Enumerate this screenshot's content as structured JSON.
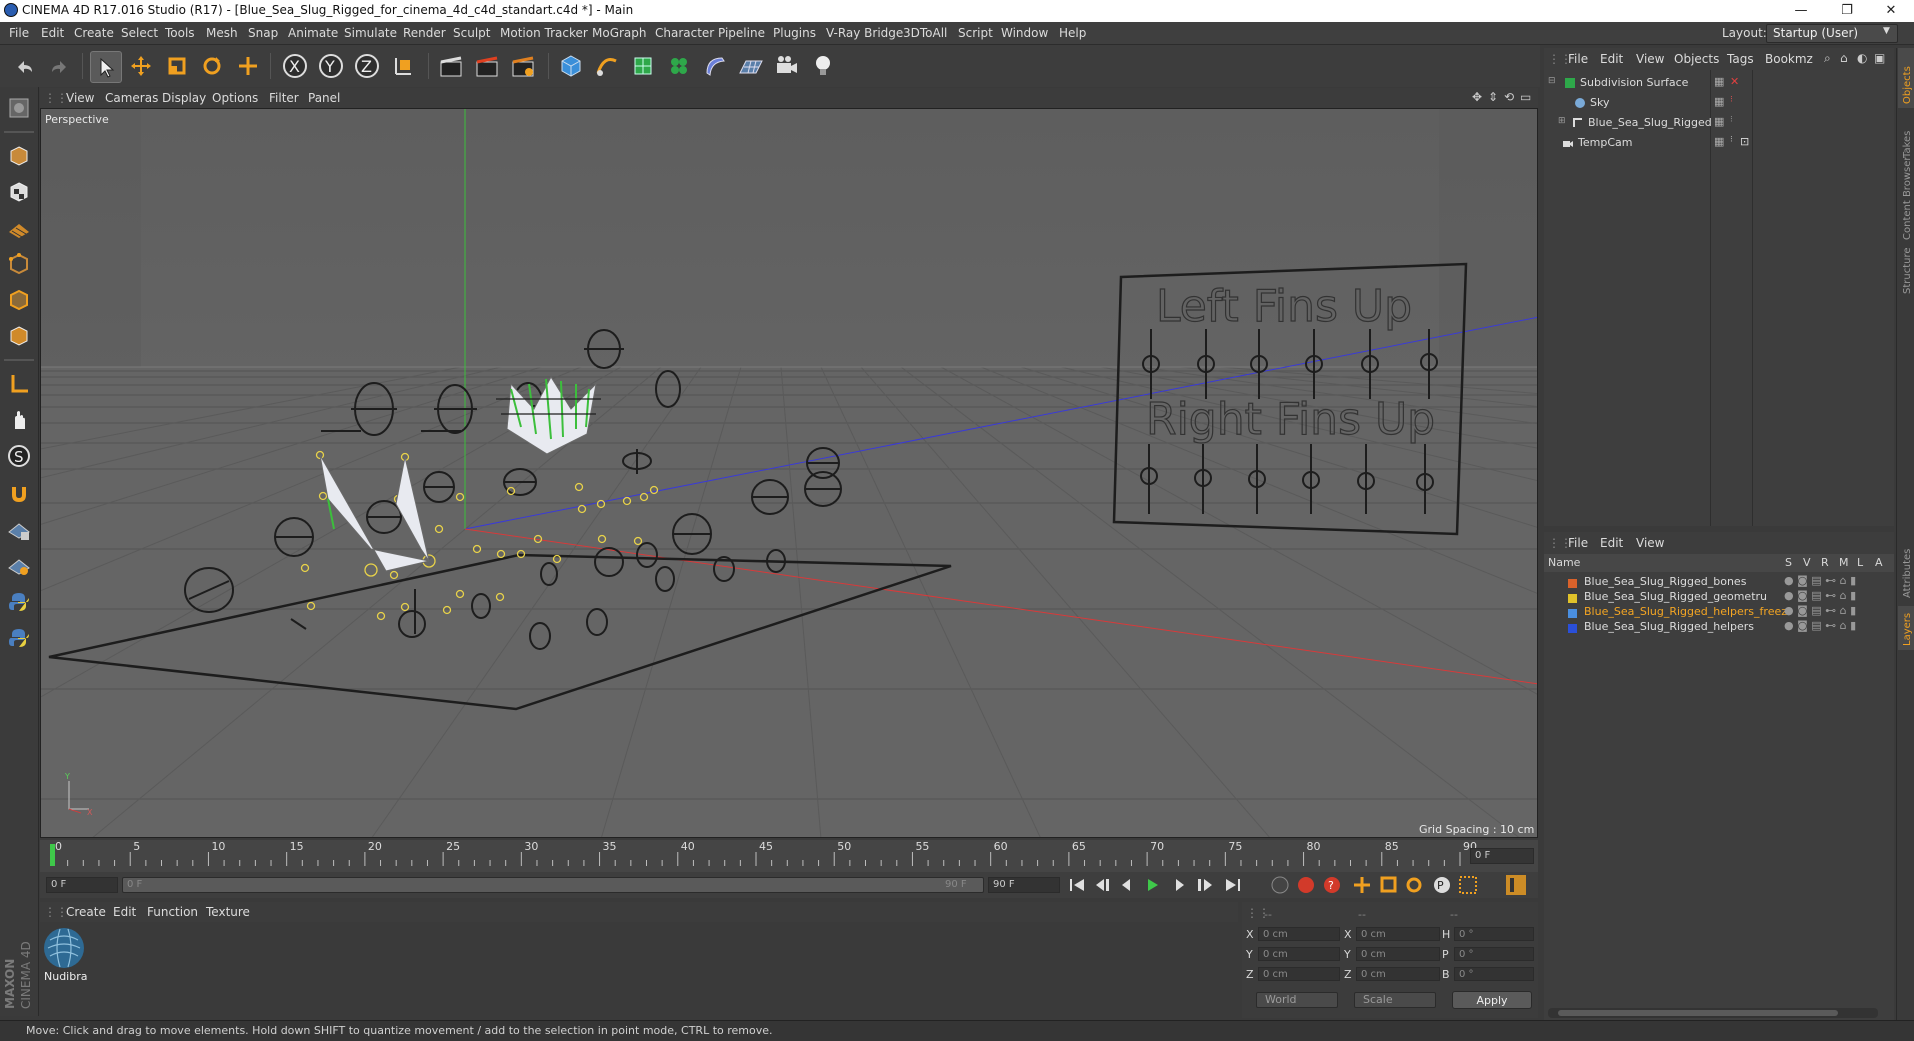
{
  "window": {
    "title": "CINEMA 4D R17.016 Studio (R17) - [Blue_Sea_Slug_Rigged_for_cinema_4d_c4d_standart.c4d *] - Main",
    "minimize": "—",
    "maximize": "❐",
    "close": "✕"
  },
  "menubar": {
    "items": [
      "File",
      "Edit",
      "Create",
      "Select",
      "Tools",
      "Mesh",
      "Snap",
      "Animate",
      "Simulate",
      "Render",
      "Sculpt",
      "Motion Tracker",
      "MoGraph",
      "Character",
      "Pipeline",
      "Plugins",
      "V-Ray Bridge",
      "3DToAll",
      "Script",
      "Window",
      "Help"
    ],
    "layout_label": "Layout:",
    "layout_value": "Startup (User)"
  },
  "viewport": {
    "menu": [
      "View",
      "Cameras",
      "Display",
      "Options",
      "Filter",
      "Panel"
    ],
    "camera_label": "Perspective",
    "grid_spacing": "Grid Spacing : 10 cm",
    "board_text_top": "Left Fins Up",
    "board_text_bottom": "Right Fins Up"
  },
  "timeline": {
    "ticks": [
      "0",
      "5",
      "10",
      "15",
      "20",
      "25",
      "30",
      "35",
      "40",
      "45",
      "50",
      "55",
      "60",
      "65",
      "70",
      "75",
      "80",
      "85",
      "90"
    ],
    "current_frame": "0 F",
    "start_field": "0 F",
    "range_start": "0 F",
    "range_end": "90 F",
    "end_field": "90 F"
  },
  "material_manager": {
    "menu": [
      "Create",
      "Edit",
      "Function",
      "Texture"
    ],
    "material_name": "Nudibra"
  },
  "coordinates": {
    "header": [
      "--",
      "--",
      "--"
    ],
    "rows": [
      {
        "a": "X",
        "av": "0 cm",
        "b": "X",
        "bv": "0 cm",
        "c": "H",
        "cv": "0 °"
      },
      {
        "a": "Y",
        "av": "0 cm",
        "b": "Y",
        "bv": "0 cm",
        "c": "P",
        "cv": "0 °"
      },
      {
        "a": "Z",
        "av": "0 cm",
        "b": "Z",
        "bv": "0 cm",
        "c": "B",
        "cv": "0 °"
      }
    ],
    "world": "World",
    "scale": "Scale",
    "apply": "Apply"
  },
  "object_manager": {
    "menu": [
      "File",
      "Edit",
      "View",
      "Objects",
      "Tags",
      "Bookmz"
    ],
    "objects": [
      {
        "name": "Subdivision Surface",
        "indent": 0
      },
      {
        "name": "Sky",
        "indent": 1
      },
      {
        "name": "Blue_Sea_Slug_Rigged",
        "indent": 1
      },
      {
        "name": "TempCam",
        "indent": 0
      }
    ]
  },
  "layer_manager": {
    "menu": [
      "File",
      "Edit",
      "View"
    ],
    "columns": [
      "Name",
      "S",
      "V",
      "R",
      "M",
      "L",
      "A"
    ],
    "layers": [
      {
        "name": "Blue_Sea_Slug_Rigged_bones",
        "color": "#d9622b"
      },
      {
        "name": "Blue_Sea_Slug_Rigged_geometru",
        "color": "#e0c22a"
      },
      {
        "name": "Blue_Sea_Slug_Rigged_helpers_freez",
        "color": "#4a8fe0"
      },
      {
        "name": "Blue_Sea_Slug_Rigged_helpers",
        "color": "#2a4fd9"
      }
    ]
  },
  "right_tabs": [
    "Objects",
    "Takes",
    "Content Browser",
    "Structure",
    "Attributes",
    "Layers"
  ],
  "status": "Move: Click and drag to move elements. Hold down SHIFT to quantize movement / add to the selection in point mode, CTRL to remove.",
  "brand": "MAXON CINEMA 4D",
  "colors": {
    "accent": "#f0a020",
    "highlight": "#f5a623"
  }
}
